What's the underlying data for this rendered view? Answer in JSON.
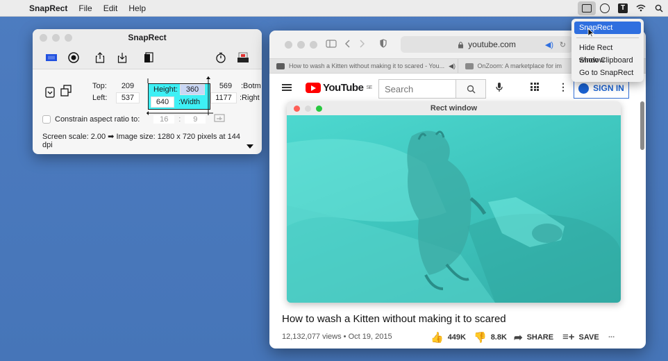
{
  "menubar": {
    "app": "SnapRect",
    "items": [
      "File",
      "Edit",
      "Help"
    ],
    "status_icons": [
      "snaprect-icon",
      "vpn-icon",
      "typora-icon",
      "wifi-icon",
      "search-icon"
    ]
  },
  "dropdown": {
    "items": [
      "SnapRect",
      "Hide Rect window",
      "Show Clipboard",
      "Go to SnapRect"
    ],
    "selected": "SnapRect"
  },
  "snaprect": {
    "title": "SnapRect",
    "top_label": "Top:",
    "top_value": "209",
    "left_label": "Left:",
    "left_value": "537",
    "height_label": "Height:",
    "height_value": "360",
    "width_value": "640",
    "width_label": ":Width",
    "botm_value": "569",
    "botm_label": ":Botm",
    "right_value": "1177",
    "right_label": ":Right",
    "constrain_label": "Constrain aspect ratio to:",
    "ratio_w": "16",
    "ratio_sep": ":",
    "ratio_h": "9",
    "scale_text": "Screen scale: 2.00 ➡ Image size: 1280 x 720 pixels at 144 dpi"
  },
  "safari": {
    "url": "youtube.com",
    "tabs": [
      {
        "label": "How to wash a Kitten without making it to scared - You..."
      },
      {
        "label": "OnZoom: A marketplace for im"
      }
    ]
  },
  "youtube": {
    "logo": "YouTube",
    "logo_region": "SE",
    "search_placeholder": "Search",
    "signin": "SIGN IN",
    "video_title": "How to wash a Kitten without making it to scared",
    "meta": "12,132,077 views • Oct 19, 2015",
    "likes": "449K",
    "dislikes": "8.8K",
    "share": "SHARE",
    "save": "SAVE",
    "more": "..."
  },
  "rect_window": {
    "title": "Rect window"
  }
}
